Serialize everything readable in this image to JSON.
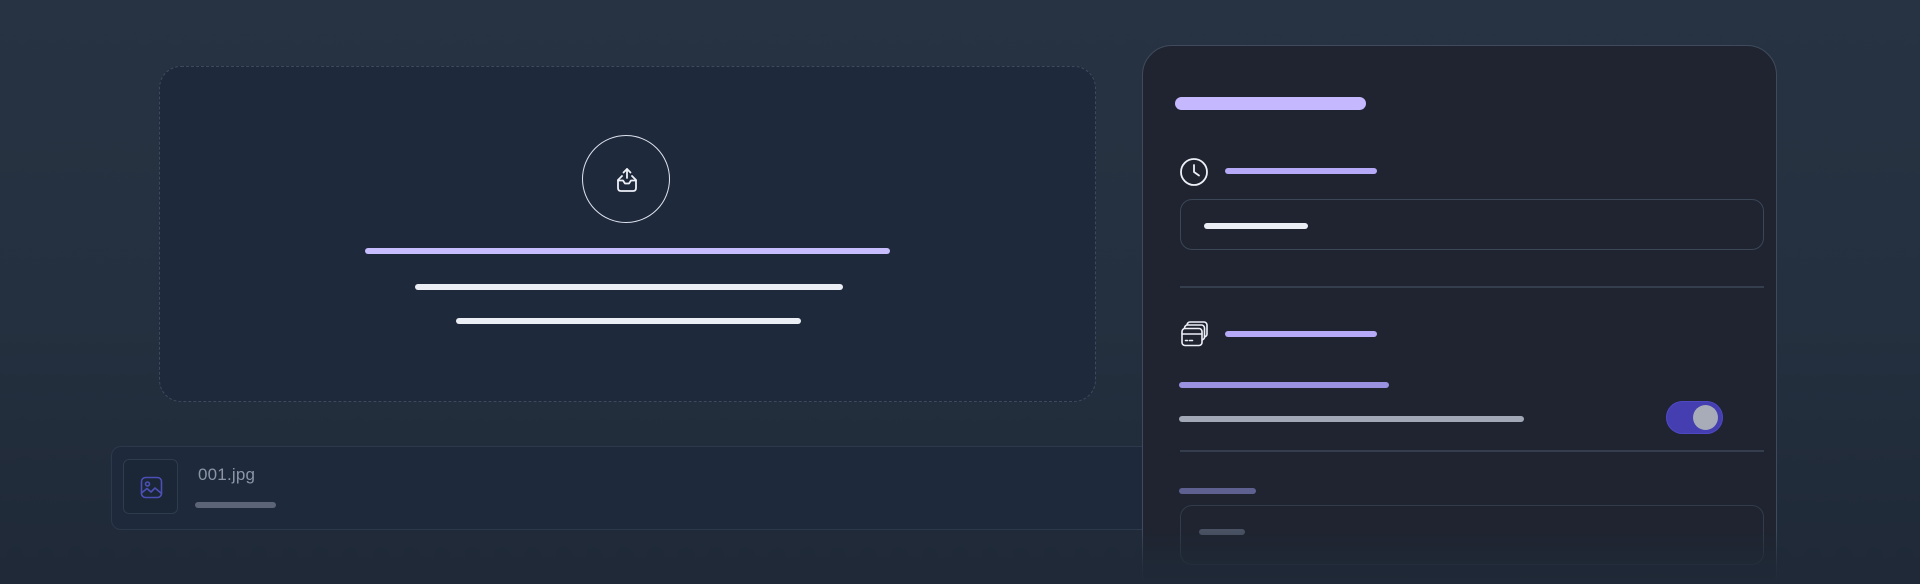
{
  "upload": {
    "icon": "upload-inbox-icon"
  },
  "file_list": {
    "items": [
      {
        "name": "001.jpg",
        "icon": "image-icon"
      }
    ]
  },
  "settings_panel": {
    "sections": [
      {
        "icon": "clock-icon"
      },
      {
        "icon": "credit-cards-icon"
      }
    ],
    "toggle": {
      "on": true
    }
  },
  "colors": {
    "accent": "#c4b5fd",
    "toggle_track": "#443eb0",
    "panel_bg": "#1f2430",
    "dropzone_bg": "#1e2a3b"
  }
}
